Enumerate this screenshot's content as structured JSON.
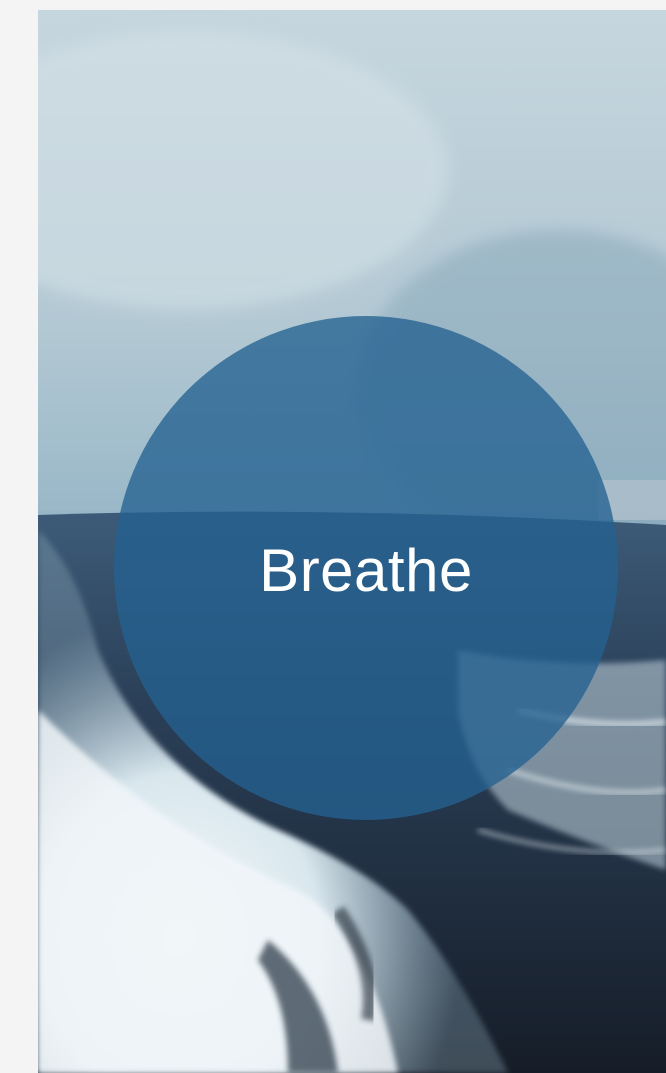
{
  "screen": {
    "background_description_color": "#8fb0c0"
  },
  "breathe_button": {
    "label": "Breathe",
    "fill_color": "#246291"
  },
  "colors": {
    "sky": "#b9cdd8",
    "fog": "#9fbccb",
    "sea_dark": "#1f2a38",
    "sea_mid": "#2f4a66",
    "foam": "#e8f1f5"
  }
}
